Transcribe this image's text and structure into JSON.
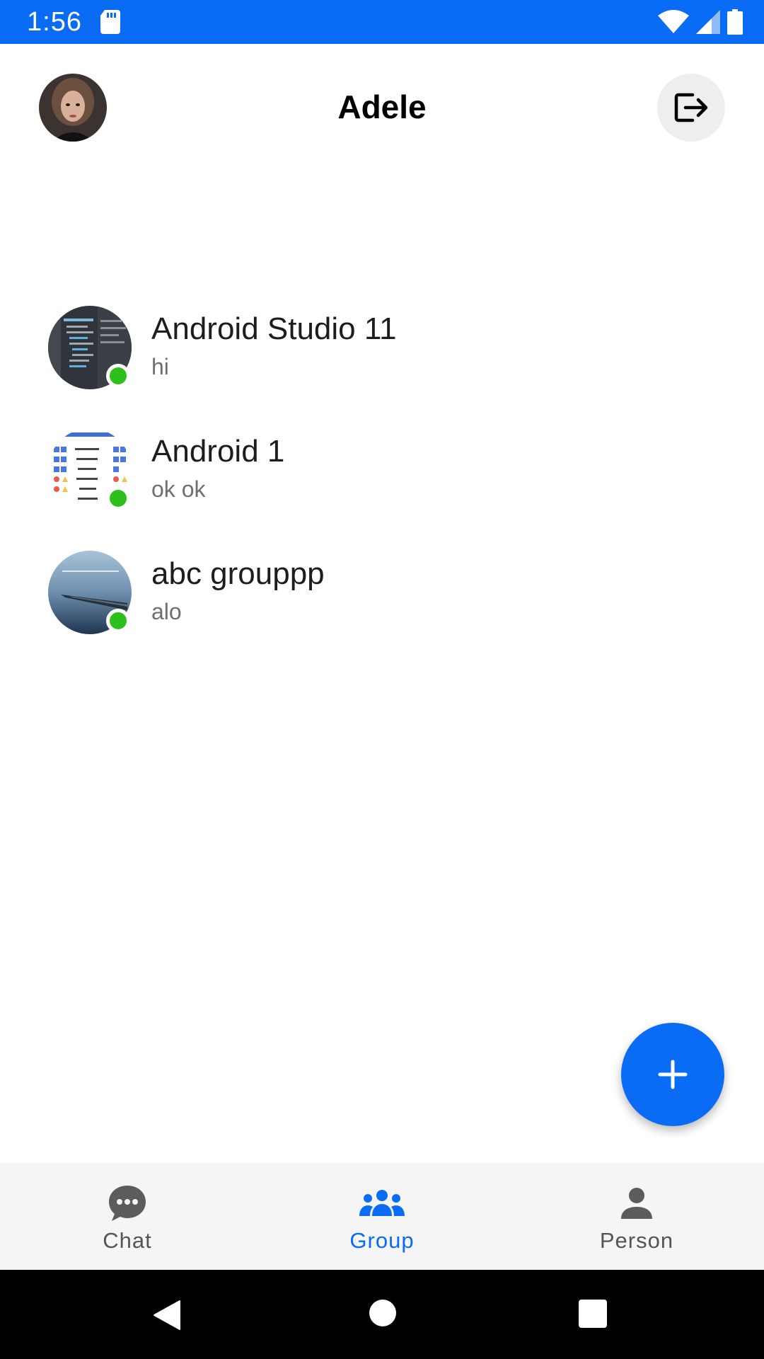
{
  "status_bar": {
    "time": "1:56",
    "background": "#0a6cf5",
    "icons": [
      "sd-card-icon",
      "wifi-icon",
      "signal-icon",
      "battery-icon"
    ]
  },
  "header": {
    "title": "Adele",
    "avatar_icon": "profile-avatar",
    "action_icon": "logout-icon"
  },
  "groups": [
    {
      "name": "Android Studio 11",
      "last_message": "hi",
      "online": true
    },
    {
      "name": "Android 1",
      "last_message": "ok ok",
      "online": true
    },
    {
      "name": "abc grouppp",
      "last_message": "alo",
      "online": true
    }
  ],
  "fab": {
    "icon": "plus-icon",
    "color": "#0a6cf5"
  },
  "bottom_nav": {
    "items": [
      {
        "label": "Chat",
        "icon": "chat-bubble-icon",
        "active": false
      },
      {
        "label": "Group",
        "icon": "group-icon",
        "active": true
      },
      {
        "label": "Person",
        "icon": "person-icon",
        "active": false
      }
    ],
    "active_color": "#0a6cf5",
    "inactive_color": "#555555"
  },
  "colors": {
    "accent": "#0a6cf5",
    "online": "#2ec01a"
  }
}
